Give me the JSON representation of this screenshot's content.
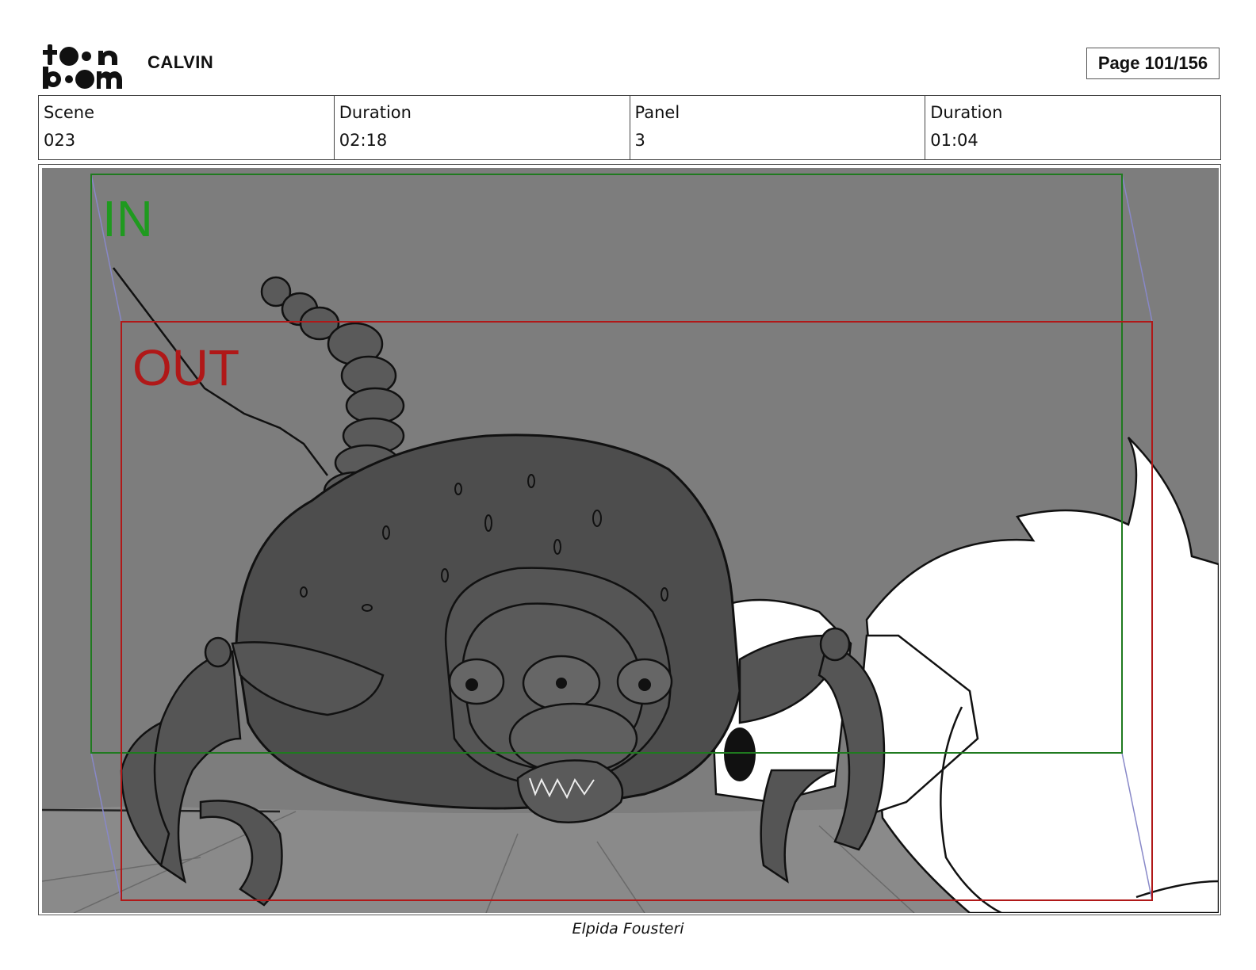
{
  "brand": {
    "logo": "toon boom",
    "logo_icon": "toon-boom-logo"
  },
  "header": {
    "project": "CALVIN",
    "page": "Page 101/156"
  },
  "info": [
    {
      "label": "Scene",
      "value": "023"
    },
    {
      "label": "Duration",
      "value": "02:18"
    },
    {
      "label": "Panel",
      "value": "3"
    },
    {
      "label": "Duration",
      "value": "01:04"
    }
  ],
  "panel": {
    "in_label": "IN",
    "out_label": "OUT",
    "in_color": "#1f7a1f",
    "out_color": "#b01818",
    "guide_color": "#8888c8",
    "background": "#7d7d7d"
  },
  "footer": {
    "author": "Elpida Fousteri"
  }
}
